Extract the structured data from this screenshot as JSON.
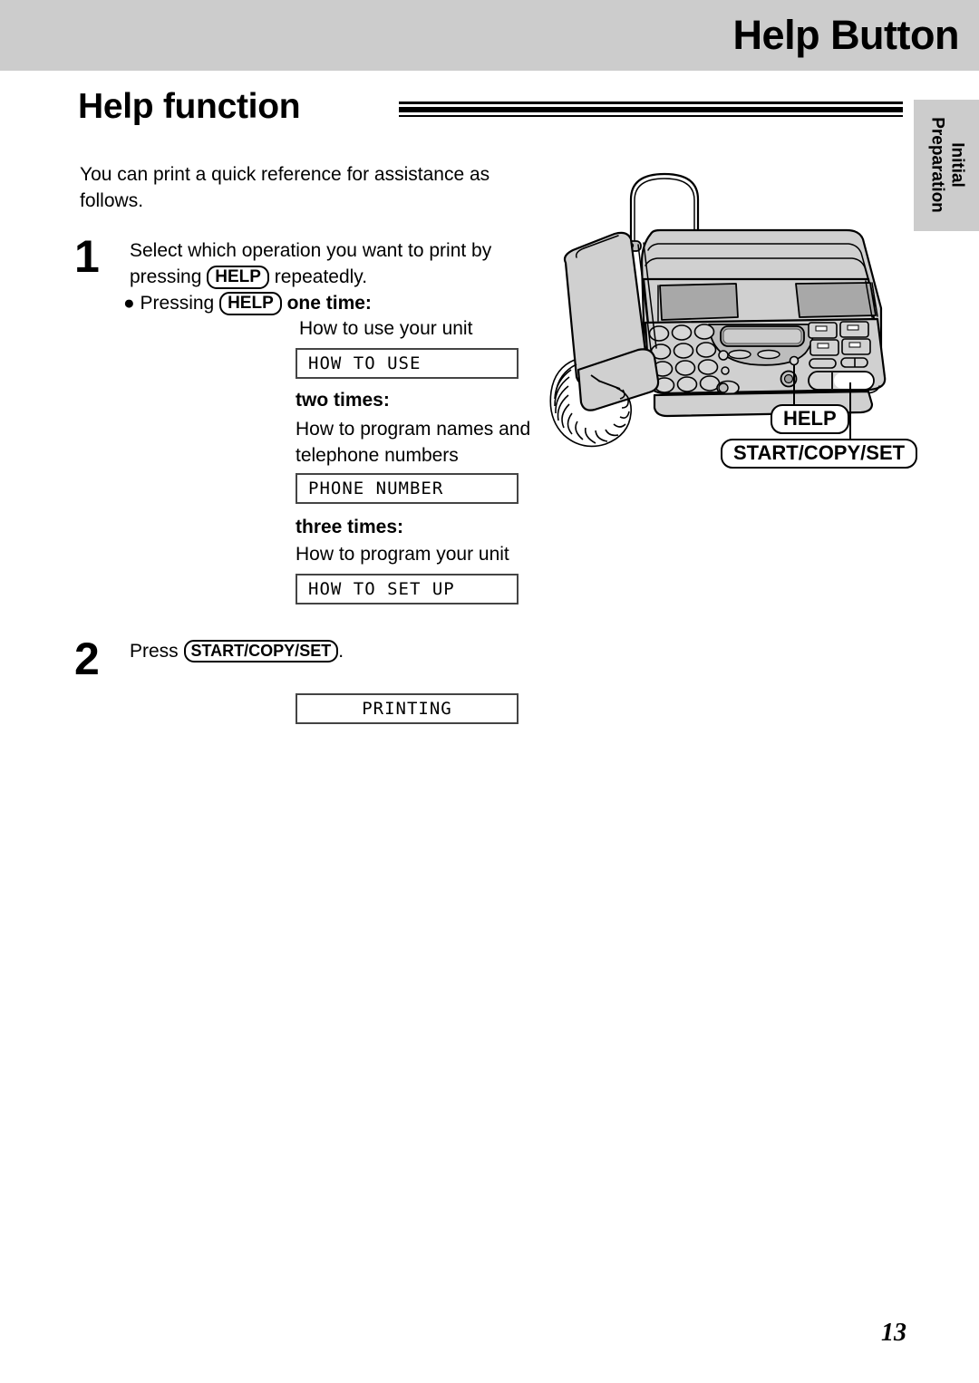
{
  "header": {
    "title": "Help Button"
  },
  "side_tab": {
    "label": "Initial\nPreparation"
  },
  "section": {
    "heading": "Help function"
  },
  "intro": {
    "text": "You can print a quick reference for assistance as follows."
  },
  "steps": [
    {
      "number": "1",
      "line1": "Select which operation you want to print by",
      "line2_pre": "pressing ",
      "line2_key": "HELP",
      "line2_post": " repeatedly.",
      "bullet_marker": "●",
      "bullet_pre": " Pressing ",
      "bullet_key": "HELP",
      "bullet_post": " one time:"
    },
    {
      "number": "2",
      "pre": "Press ",
      "key": "START/COPY/SET",
      "post": "."
    }
  ],
  "options": [
    {
      "label": "",
      "description": "How to use your unit",
      "lcd": "HOW TO USE"
    },
    {
      "label": "two times:",
      "description": "How to program names and telephone numbers",
      "lcd": "PHONE NUMBER"
    },
    {
      "label": "three times:",
      "description": "How to program your unit",
      "lcd": "HOW TO SET UP"
    }
  ],
  "result_lcd": "PRINTING",
  "illustration": {
    "callout_help": "HELP",
    "callout_start": "START/COPY/SET",
    "alt": "fax-machine-with-handset"
  },
  "page_number": "13",
  "colors": {
    "header_bar": "#cccccc",
    "side_tab": "#cccccc",
    "ink": "#000000",
    "machine_body": "#d0d0d0",
    "machine_shade": "#b8b8b8"
  }
}
